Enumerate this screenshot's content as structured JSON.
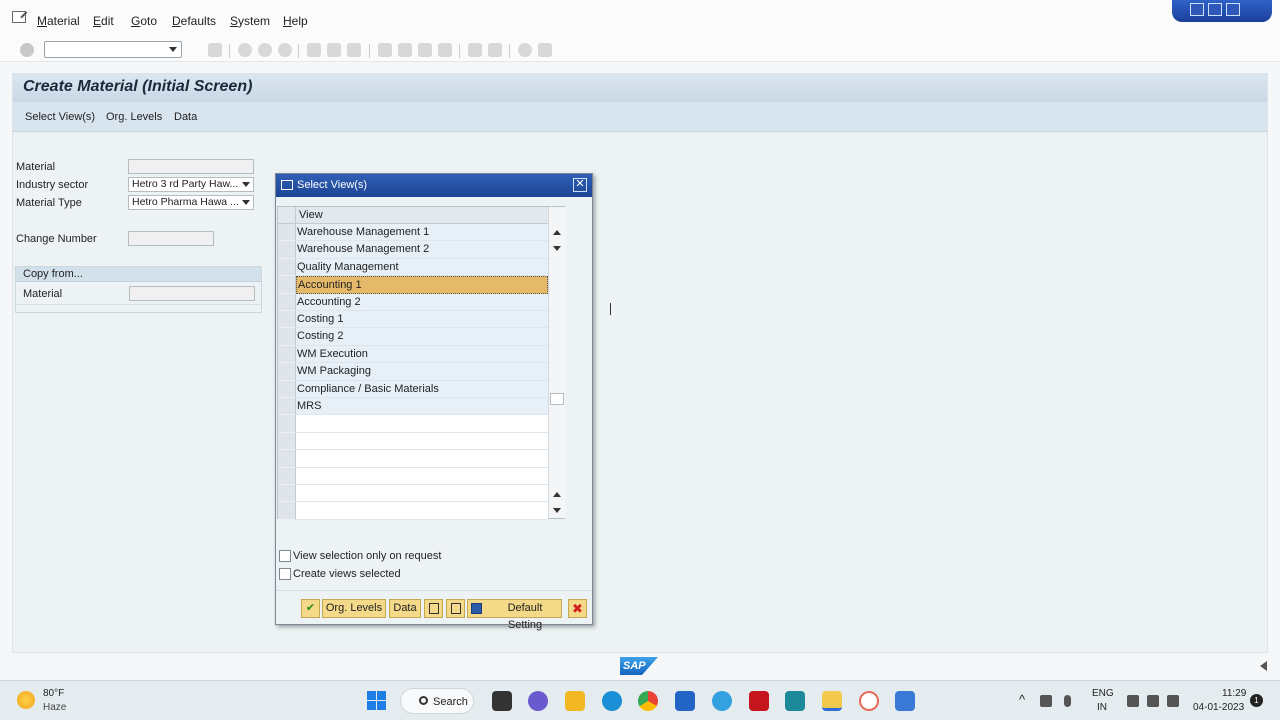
{
  "menu": {
    "items": [
      {
        "label": "Material",
        "ul": "M",
        "rest": "aterial"
      },
      {
        "label": "Edit",
        "ul": "E",
        "rest": "dit"
      },
      {
        "label": "Goto",
        "ul": "G",
        "rest": "oto"
      },
      {
        "label": "Defaults",
        "ul": "D",
        "rest": "efaults"
      },
      {
        "label": "System",
        "ul": "S",
        "rest": "ystem"
      },
      {
        "label": "Help",
        "ul": "H",
        "rest": "elp"
      }
    ]
  },
  "screen": {
    "title": "Create Material (Initial Screen)",
    "app_toolbar": [
      "Select View(s)",
      "Org. Levels",
      "Data"
    ]
  },
  "form": {
    "material_label": "Material",
    "industry_sector_label": "Industry sector",
    "industry_sector_value": "Hetro 3 rd Party Haw...",
    "material_type_label": "Material Type",
    "material_type_value": "Hetro Pharma Hawa ...",
    "change_number_label": "Change Number",
    "copy_from_label": "Copy from...",
    "copy_material_label": "Material"
  },
  "dialog": {
    "title": "Select View(s)",
    "close_glyph": "✕",
    "column_header": "View",
    "rows": [
      "Warehouse Management 1",
      "Warehouse Management 2",
      "Quality Management",
      "Accounting 1",
      "Accounting 2",
      "Costing 1",
      "Costing 2",
      "WM Execution",
      "WM Packaging",
      "Compliance / Basic Materials",
      "MRS"
    ],
    "selected_row": "Accounting 1",
    "checkbox_view_selection": "View selection only on request",
    "checkbox_create_views": "Create views selected",
    "buttons": {
      "org_levels": "Org. Levels",
      "data": "Data",
      "default_setting": "Default Setting"
    }
  },
  "status": {
    "logo": "SAP"
  },
  "taskbar": {
    "temperature": "80°F",
    "weather": "Haze",
    "search": "Search",
    "lang_top": "ENG",
    "lang_bottom": "IN",
    "time": "11:29",
    "date": "04-01-2023",
    "notification_count": "1"
  },
  "colors": {
    "accent_blue": "#1d4596",
    "selected_row": "#e5b96a",
    "button_yellow": "#f3d988"
  }
}
